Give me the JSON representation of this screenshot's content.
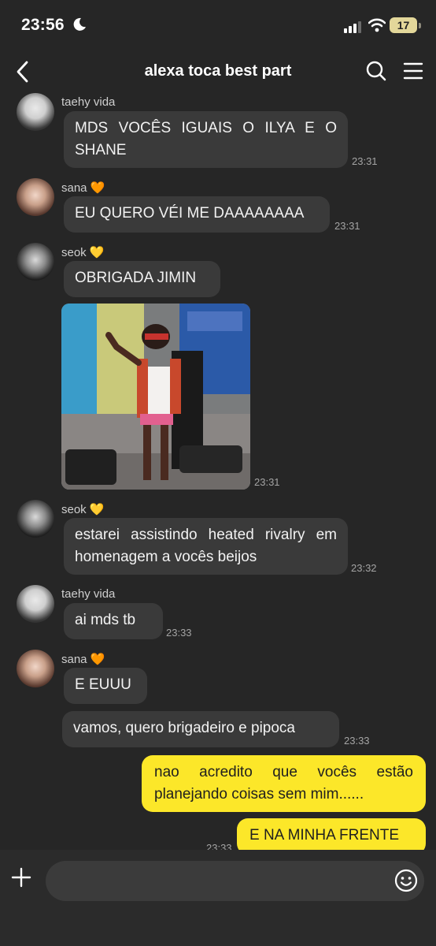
{
  "status": {
    "time": "23:56",
    "battery": "17"
  },
  "header": {
    "title": "alexa toca best part"
  },
  "messages": [
    {
      "sender": "taehy vida",
      "text": "MDS VOCÊS IGUAIS O ILYA E O SHANE",
      "time": "23:31"
    },
    {
      "sender": "sana",
      "heart": "🧡",
      "text": "EU QUERO VÉI ME DAAAAAAAA",
      "time": "23:31"
    },
    {
      "sender": "seok",
      "heart": "💛",
      "text": "OBRIGADA JIMIN"
    },
    {
      "media_time": "23:31"
    },
    {
      "sender": "seok",
      "heart": "💛",
      "text": "estarei assistindo heated rivalry em homenagem a vocês beijos",
      "time": "23:32"
    },
    {
      "sender": "taehy vida",
      "text": "ai mds tb",
      "time": "23:33"
    },
    {
      "sender": "sana",
      "heart": "🧡",
      "text": "E EUUU"
    },
    {
      "text": "vamos, quero brigadeiro e pipoca",
      "time": "23:33"
    }
  ],
  "outgoing": [
    {
      "text": "nao acredito que vocês estão planejando coisas sem mim......"
    },
    {
      "text": "E NA MINHA FRENTE",
      "time": "23:33"
    }
  ],
  "composer": {
    "value": ""
  },
  "icons": {
    "back": "chevron-left-icon",
    "search": "search-icon",
    "menu": "hamburger-menu-icon",
    "plus": "plus-icon",
    "emoji": "smiley-icon"
  },
  "colors": {
    "background": "#262626",
    "incoming_bubble": "#3a3a3a",
    "outgoing_bubble": "#fce729"
  }
}
